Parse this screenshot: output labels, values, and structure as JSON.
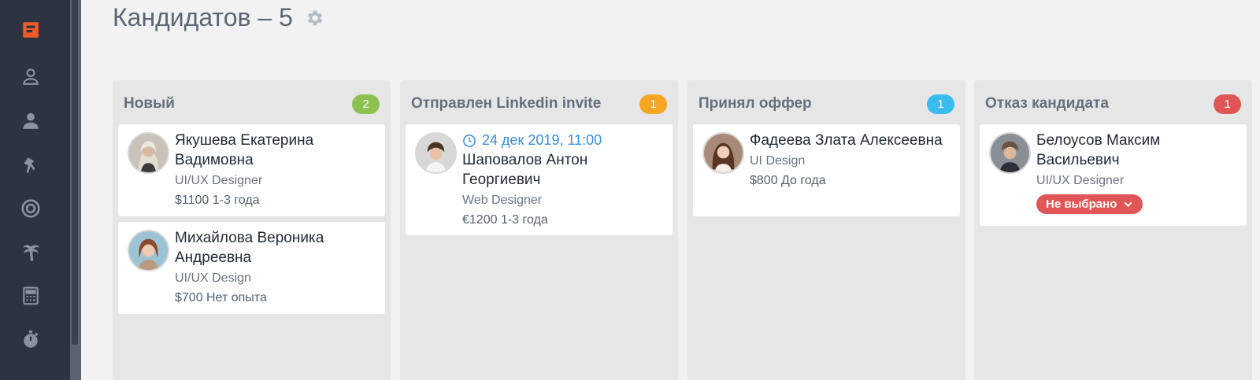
{
  "page": {
    "title": "Кандидатов – 5"
  },
  "sidebar": {
    "items": [
      {
        "icon": "logo-icon"
      },
      {
        "icon": "user-outline-icon"
      },
      {
        "icon": "user-icon"
      },
      {
        "icon": "pin-icon"
      },
      {
        "icon": "target-icon"
      },
      {
        "icon": "palm-tree-icon"
      },
      {
        "icon": "calculator-icon"
      },
      {
        "icon": "stopwatch-icon"
      }
    ]
  },
  "colors": {
    "green": "#8cc152",
    "orange": "#f5a623",
    "blue": "#3bbbef",
    "red": "#e05656",
    "link": "#3a8fd8"
  },
  "columns": [
    {
      "title": "Новый",
      "count": "2",
      "badge_color": "#8cc152",
      "cards": [
        {
          "name": "Якушева Екатерина Вадимовна",
          "role": "UI/UX Designer",
          "salary": "$1100 1-3 года"
        },
        {
          "name": "Михайлова Вероника Андреевна",
          "role": "UI/UX Design",
          "salary": "$700 Нет опыта"
        }
      ]
    },
    {
      "title": "Отправлен Linkedin invite",
      "count": "1",
      "badge_color": "#f5a623",
      "cards": [
        {
          "date": "24 дек 2019, 11:00",
          "name": "Шаповалов Антон Георгиевич",
          "role": "Web Designer",
          "salary": "€1200 1-3 года"
        }
      ]
    },
    {
      "title": "Принял оффер",
      "count": "1",
      "badge_color": "#3bbbef",
      "cards": [
        {
          "name": "Фадеева Злата Алексеевна",
          "role": "UI Design",
          "salary": "$800 До года"
        }
      ]
    },
    {
      "title": "Отказ кандидата",
      "count": "1",
      "badge_color": "#e05656",
      "cards": [
        {
          "name": "Белоусов Максим Васильевич",
          "role": "UI/UX Designer",
          "status": "Не выбрано"
        }
      ]
    }
  ]
}
